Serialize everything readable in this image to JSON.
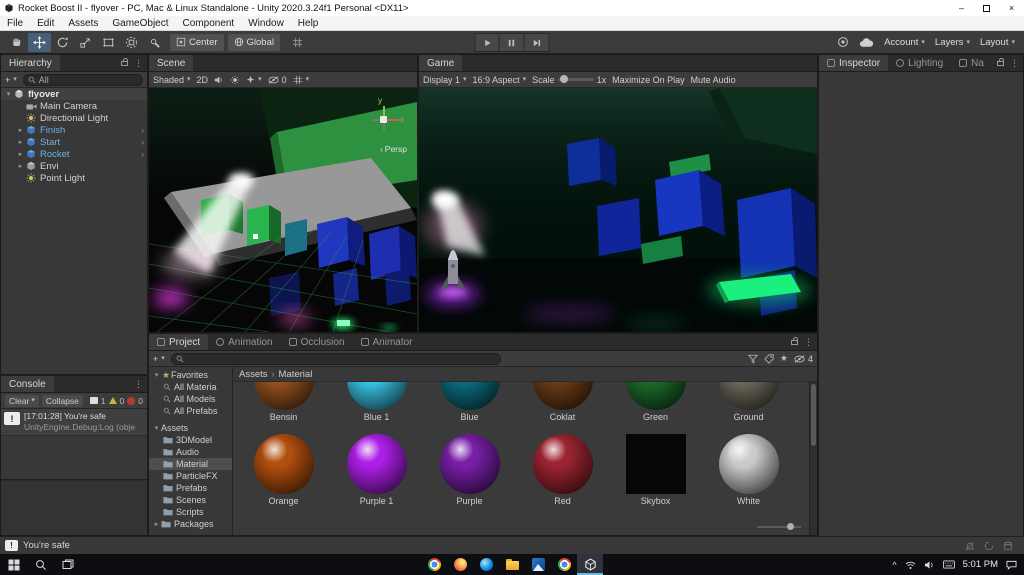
{
  "titlebar": {
    "title": "Rocket Boost II - flyover - PC, Mac & Linux Standalone - Unity 2020.3.24f1 Personal <DX11>"
  },
  "menubar": {
    "items": [
      "File",
      "Edit",
      "Assets",
      "GameObject",
      "Component",
      "Window",
      "Help"
    ]
  },
  "toolbar": {
    "pivot": "Center",
    "orientation": "Global",
    "account": "Account",
    "layers": "Layers",
    "layout": "Layout"
  },
  "icons": {
    "caret_down": "▾",
    "caret_right": "▸",
    "chevron_right": "›",
    "chevron_left": "‹",
    "kebab": "⋮",
    "minimize": "–",
    "close": "×",
    "star": "★",
    "bang": "!",
    "plus": "+",
    "tray_caret": "^"
  },
  "hierarchy": {
    "tab": "Hierarchy",
    "search_text": "All",
    "scene_name": "flyover",
    "items": [
      {
        "name": "Main Camera"
      },
      {
        "name": "Directional Light"
      },
      {
        "name": "Finish"
      },
      {
        "name": "Start"
      },
      {
        "name": "Rocket"
      },
      {
        "name": "Envi"
      },
      {
        "name": "Point Light"
      }
    ]
  },
  "scene_view": {
    "tab": "Scene",
    "shading": "Shaded",
    "mode_2d": "2D",
    "hidden_count": "0",
    "axis_x": "x",
    "axis_y": "y",
    "projection": "Persp"
  },
  "game_view": {
    "tab": "Game",
    "display": "Display 1",
    "aspect": "16:9 Aspect",
    "scale_label": "Scale",
    "scale_value": "1x",
    "maximize_on_play": "Maximize On Play",
    "mute_audio": "Mute Audio"
  },
  "inspector": {
    "tab_inspector": "Inspector",
    "tab_lighting": "Lighting",
    "tab_navigation": "Na"
  },
  "console": {
    "tab": "Console",
    "clear": "Clear",
    "collapse": "Collapse",
    "log_count": "1",
    "warning_count": "0",
    "error_count": "0",
    "entry_line1": "[17:01:28] You're safe",
    "entry_line2": "UnityEngine.Debug:Log (obje"
  },
  "project": {
    "tab_project": "Project",
    "tab_animation": "Animation",
    "tab_occlusion": "Occlusion",
    "tab_animator": "Animator",
    "search_text": "",
    "favorites_label": "Favorites",
    "favorites": [
      "All Materia",
      "All Models",
      "All Prefabs"
    ],
    "assets_label": "Assets",
    "folders": [
      "3DModel",
      "Audio",
      "Material",
      "ParticleFX",
      "Prefabs",
      "Scenes",
      "Scripts"
    ],
    "packages_label": "Packages",
    "breadcrumb_root": "Assets",
    "breadcrumb_current": "Material",
    "hidden_packages_count": "4",
    "materials": [
      {
        "name": "Bensin",
        "color": "#96511f"
      },
      {
        "name": "Blue 1",
        "color": "#38c4e6"
      },
      {
        "name": "Blue",
        "color": "#0b6c7e"
      },
      {
        "name": "Coklat",
        "color": "#6b3c18"
      },
      {
        "name": "Green",
        "color": "#1c6b2a"
      },
      {
        "name": "Ground",
        "color": "#6d675a"
      },
      {
        "name": "Orange",
        "color": "#b24f0e"
      },
      {
        "name": "Purple 1",
        "color": "#ad1fe8"
      },
      {
        "name": "Purple",
        "color": "#781fa6"
      },
      {
        "name": "Red",
        "color": "#9c2430"
      },
      {
        "name": "Skybox",
        "color": "#060606"
      },
      {
        "name": "White",
        "color": "#cbcbcb"
      }
    ]
  },
  "statusbar": {
    "message": "You're safe"
  },
  "taskbar": {
    "time": "5:01 PM"
  },
  "colors": {
    "prefab_text": "#6eb2e6",
    "tool_selected": "#46607c",
    "selection_gray": "#4d4d4d"
  }
}
